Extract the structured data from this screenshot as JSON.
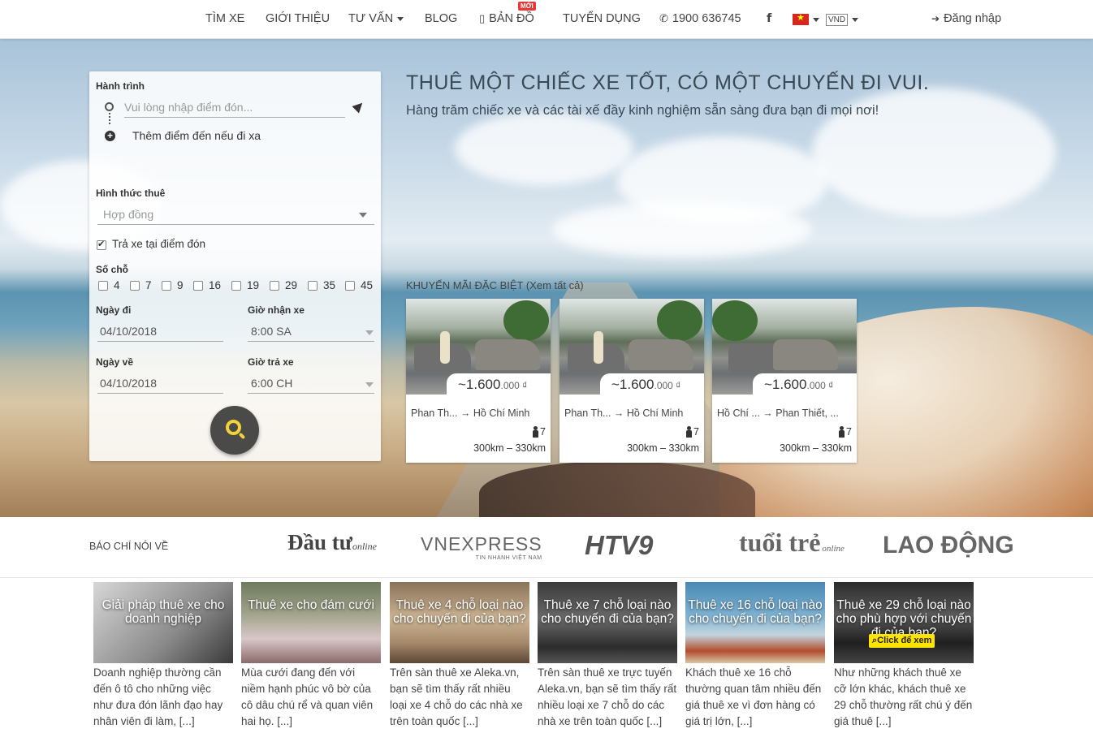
{
  "nav": {
    "items": [
      "TÌM XE",
      "GIỚI THIỆU",
      "TƯ VẤN",
      "BLOG",
      "BẢN ĐỒ",
      "TUYỂN DỤNG"
    ],
    "new_badge": "MỚI",
    "phone": "1900 636745",
    "facebook": "f",
    "currency": "VND",
    "login": "Đăng nhập"
  },
  "hero": {
    "title": "THUÊ MỘT CHIẾC XE TỐT, CÓ MỘT CHUYẾN ĐI VUI.",
    "subtitle": "Hàng trăm chiếc xe và các tài xế đầy kinh nghiệm sẵn sàng đưa bạn đi mọi nơi!"
  },
  "search": {
    "itinerary_label": "Hành trình",
    "pickup_placeholder": "Vui lòng nhập điểm đón...",
    "add_destination": "Thêm điểm đến nếu đi xa",
    "rent_type_label": "Hình thức thuê",
    "rent_type_value": "Hợp đồng",
    "return_at_pickup": "Trả xe tại điểm đón",
    "seats_label": "Số chỗ",
    "seats": [
      "4",
      "7",
      "9",
      "16",
      "19",
      "29",
      "35",
      "45"
    ],
    "depart_label": "Ngày đi",
    "depart_value": "04/10/2018",
    "pickup_time_label": "Giờ nhận xe",
    "pickup_time_value": "8:00 SA",
    "return_label": "Ngày về",
    "return_value": "04/10/2018",
    "return_time_label": "Giờ trả xe",
    "return_time_value": "6:00 CH"
  },
  "promos": {
    "title": "KHUYẾN MÃI ĐẶC BIỆT (Xem tất cả)",
    "cards": [
      {
        "price_main": "~1.600",
        "price_minor": ".000 ₫",
        "route": "Phan Th... → Hồ Chí Minh",
        "seats": "7",
        "distance": "300km – 330km"
      },
      {
        "price_main": "~1.600",
        "price_minor": ".000 ₫",
        "route": "Phan Th... → Hồ Chí Minh",
        "seats": "7",
        "distance": "300km – 330km"
      },
      {
        "price_main": "~1.600",
        "price_minor": ".000 ₫",
        "route": "Hồ Chí ... → Phan Thiết, ...",
        "seats": "7",
        "distance": "300km – 330km"
      }
    ]
  },
  "press": {
    "label": "BÁO CHÍ NÓI VỀ",
    "logos": [
      "Đầu tư",
      "VNEXPRESS",
      "HTV9",
      "tuổi trẻ",
      "LAO ĐỘNG"
    ],
    "logo_subs": [
      "online",
      "TIN NHANH VIỆT NAM",
      "online"
    ]
  },
  "articles": [
    {
      "title": "Giải pháp thuê xe cho doanh nghiệp",
      "text": "Doanh nghiệp thường cần đến ô tô cho những việc như đưa đón lãnh đạo hay nhân viên đi làm, [...]"
    },
    {
      "title": "Thuê xe cho đám cưới",
      "text": "Mùa cưới đang đến với niềm hạnh phúc vô bờ của cô dâu chú rể và quan viên hai họ. [...]"
    },
    {
      "title": "Thuê xe 4 chỗ loại nào cho chuyến đi của bạn?",
      "text": "Trên sàn thuê xe Aleka.vn, bạn sẽ tìm thấy rất nhiều loại xe 4 chỗ do các nhà xe trên toàn quốc [...]"
    },
    {
      "title": "Thuê xe 7 chỗ loại nào cho chuyến đi của bạn?",
      "text": "Trên sàn thuê xe trực tuyến Aleka.vn, bạn sẽ tìm thấy rất nhiều loại xe 7 chỗ do các nhà xe trên toàn quốc [...]"
    },
    {
      "title": "Thuê xe 16 chỗ loại nào cho chuyến đi của bạn?",
      "text": "Khách thuê xe 16 chỗ thường quan tâm nhiều đến giá thuê xe vì đơn hàng có giá trị lớn, [...]"
    },
    {
      "title": "Thuê xe 29 chỗ loại nào cho phù hợp với chuyến đi của bạn?",
      "text": "Như những khách thuê xe cỡ lớn khác, khách thuê xe 29 chỗ thường rất chú ý đến giá thuê [...]"
    }
  ],
  "click_badge": "Click để xem",
  "colors": {
    "accent": "#f3d23a",
    "search_button": "#4a4a48",
    "new_badge": "#e53935"
  }
}
